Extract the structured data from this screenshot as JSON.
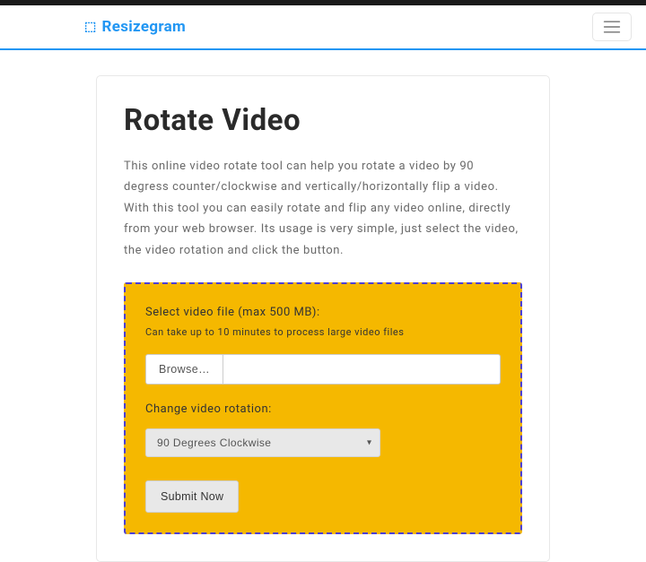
{
  "navbar": {
    "brand_icon": "⬚",
    "brand_text": "Resizegram"
  },
  "page": {
    "title": "Rotate Video",
    "description": "This online video rotate tool can help you rotate a video by 90 degress counter/clockwise and vertically/horizontally flip a video. With this tool you can easily rotate and flip any video online, directly from your web browser. Its usage is very simple, just select the video, the video rotation and click the button."
  },
  "form": {
    "file_label": "Select video file (max 500 MB):",
    "file_hint": "Can take up to 10 minutes to process large video files",
    "browse_label": "Browse…",
    "file_path": "",
    "rotation_label": "Change video rotation:",
    "rotation_selected": "90 Degrees Clockwise",
    "submit_label": "Submit Now"
  }
}
